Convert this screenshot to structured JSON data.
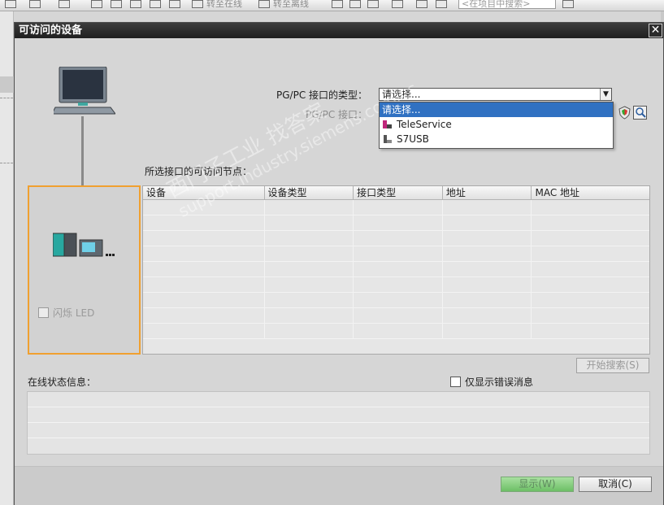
{
  "background": {
    "toolbar_text_1": "转至在线",
    "toolbar_text_2": "转至离线",
    "search_placeholder": "<在项目中搜索>"
  },
  "dialog": {
    "title": "可访问的设备",
    "close_glyph": "✕",
    "interface_type_label": "PG/PC 接口的类型：",
    "interface_label": "PG/PC 接口：",
    "select_value": "请选择...",
    "dropdown_options": [
      {
        "label": "请选择...",
        "icon": "none",
        "selected": true
      },
      {
        "label": "TeleService",
        "icon": "teleservice-icon",
        "selected": false
      },
      {
        "label": "S7USB",
        "icon": "usb-icon",
        "selected": false
      }
    ],
    "nodes_label": "所选接口的可访问节点：",
    "flash_led_label": "闪烁 LED",
    "table": {
      "columns": [
        "设备",
        "设备类型",
        "接口类型",
        "地址",
        "MAC 地址"
      ],
      "rows": []
    },
    "start_search_label": "开始搜索(S)",
    "online_status_label": "在线状态信息：",
    "only_errors_label": "仅显示错误消息",
    "show_button_label": "显示(W)",
    "cancel_button_label": "取消(C)"
  },
  "watermark": {
    "line1": "西门子工业 找答案",
    "line2": "support.industry.siemens.com/cs"
  },
  "colors": {
    "title_bar": "#2b2b2b",
    "highlight": "#3071c2",
    "node_border": "#f0a030",
    "show_button": "#6dbf66"
  }
}
